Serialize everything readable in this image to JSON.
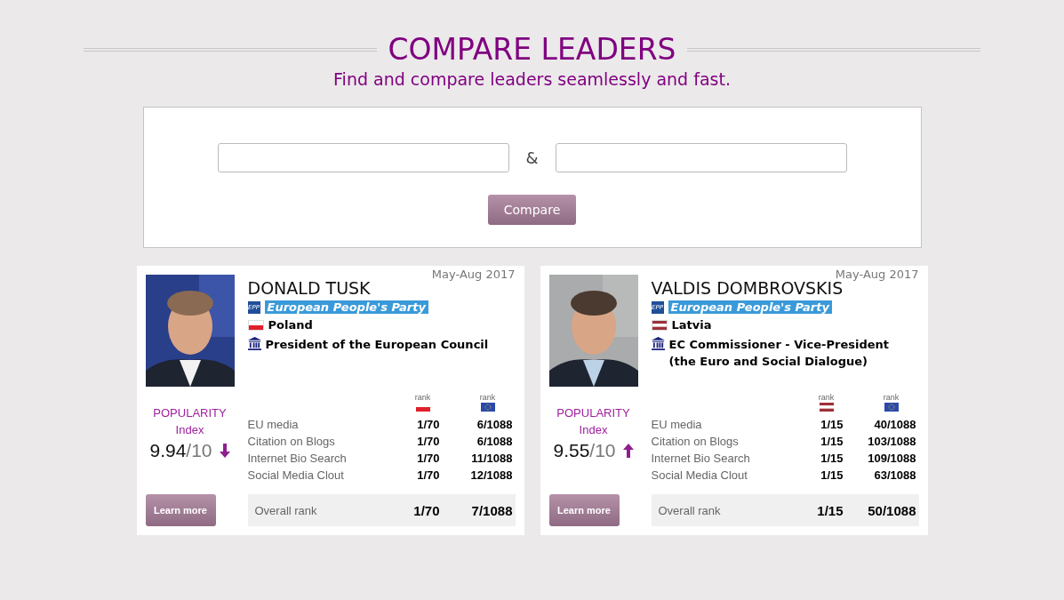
{
  "header": {
    "title": "COMPARE LEADERS",
    "subtitle": "Find and compare leaders seamlessly and fast."
  },
  "compare_form": {
    "separator": "&",
    "button": "Compare"
  },
  "leaders": [
    {
      "period": "May-Aug 2017",
      "name": "DONALD TUSK",
      "party_logo": "EPP",
      "party": "European People's Party",
      "country": "Poland",
      "flag": {
        "kind": "poland"
      },
      "office": "President of the European Council",
      "popularity_label": "POPULARITY",
      "index_label": "Index",
      "score": "9.94",
      "score_max": "/10",
      "rising": false,
      "rank_label_national": "rank",
      "rank_label_eu": "rank",
      "stats": [
        {
          "label": "EU media",
          "national": "1/70",
          "eu": "6/1088"
        },
        {
          "label": "Citation on Blogs",
          "national": "1/70",
          "eu": "6/1088"
        },
        {
          "label": "Internet Bio Search",
          "national": "1/70",
          "eu": "11/1088"
        },
        {
          "label": "Social Media Clout",
          "national": "1/70",
          "eu": "12/1088"
        }
      ],
      "overall": {
        "label": "Overall rank",
        "national": "1/70",
        "eu": "7/1088"
      },
      "button": "Learn more"
    },
    {
      "period": "May-Aug 2017",
      "name": "VALDIS DOMBROVSKIS",
      "party_logo": "EPP",
      "party": "European People's Party",
      "country": "Latvia",
      "flag": {
        "kind": "latvia"
      },
      "office": "EC Commissioner - Vice-President (the Euro and Social Dialogue)",
      "popularity_label": "POPULARITY",
      "index_label": "Index",
      "score": "9.55",
      "score_max": "/10",
      "rising": true,
      "rank_label_national": "rank",
      "rank_label_eu": "rank",
      "stats": [
        {
          "label": "EU media",
          "national": "1/15",
          "eu": "40/1088"
        },
        {
          "label": "Citation on Blogs",
          "national": "1/15",
          "eu": "103/1088"
        },
        {
          "label": "Internet Bio Search",
          "national": "1/15",
          "eu": "109/1088"
        },
        {
          "label": "Social Media Clout",
          "national": "1/15",
          "eu": "63/1088"
        }
      ],
      "overall": {
        "label": "Overall rank",
        "national": "1/15",
        "eu": "50/1088"
      },
      "button": "Learn more"
    }
  ]
}
